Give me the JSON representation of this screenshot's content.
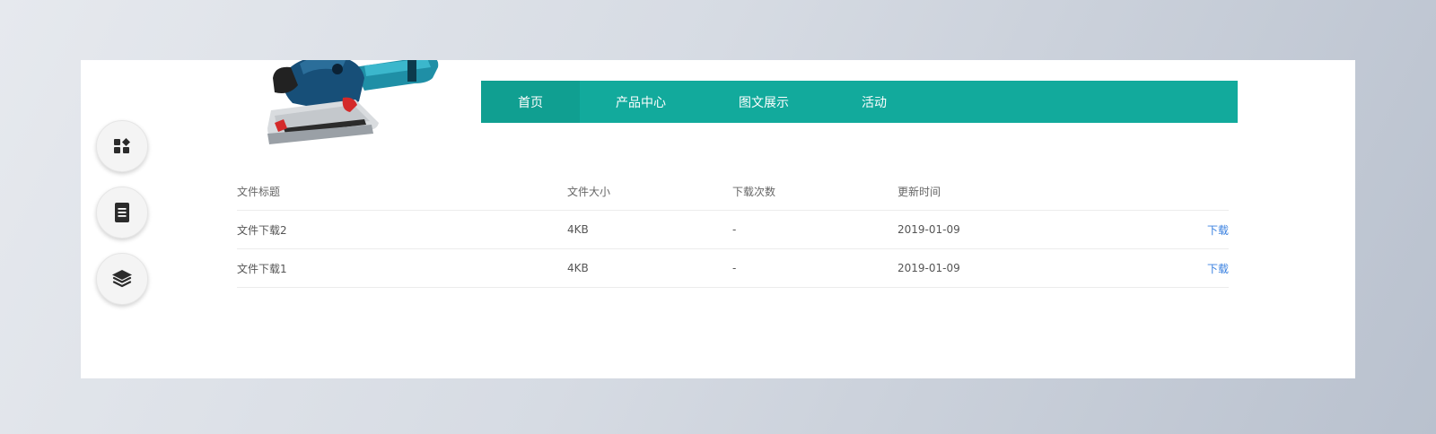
{
  "nav": {
    "items": [
      {
        "label": "首页",
        "active": true
      },
      {
        "label": "产品中心",
        "active": false
      },
      {
        "label": "图文展示",
        "active": false
      },
      {
        "label": "活动",
        "active": false
      }
    ]
  },
  "side_buttons": [
    {
      "icon": "apps-grid-icon"
    },
    {
      "icon": "document-icon"
    },
    {
      "icon": "layers-icon"
    }
  ],
  "table": {
    "headers": {
      "title": "文件标题",
      "size": "文件大小",
      "count": "下载次数",
      "date": "更新时间"
    },
    "rows": [
      {
        "title": "文件下载2",
        "size": "4KB",
        "count": "-",
        "date": "2019-01-09",
        "action": "下载"
      },
      {
        "title": "文件下载1",
        "size": "4KB",
        "count": "-",
        "date": "2019-01-09",
        "action": "下载"
      }
    ]
  },
  "colors": {
    "nav_background": "#12aa9c",
    "nav_active": "#109f91",
    "link": "#3b82e0"
  }
}
